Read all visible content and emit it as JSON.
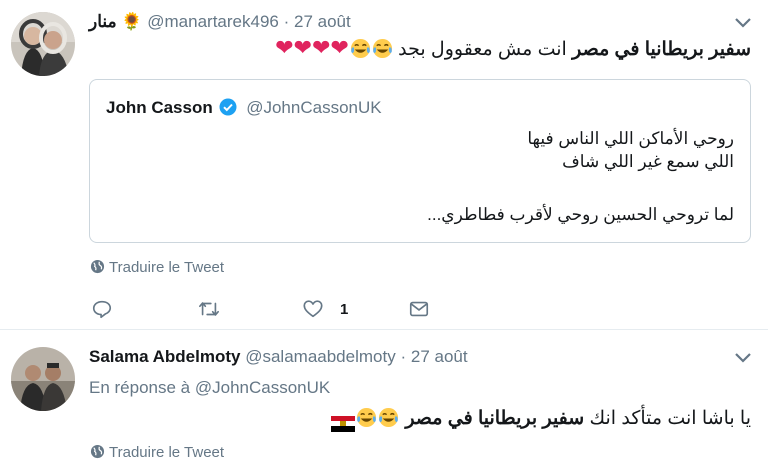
{
  "tweets": [
    {
      "name": "منار",
      "name_emoji": "🌻",
      "handle": "@manartarek496",
      "separator": "·",
      "date": "27 août",
      "text_bold": "سفير بريطانيا في مصر",
      "text_rest": " انت مش معقوول بجد ",
      "text_hearts": "❤❤❤❤",
      "quote": {
        "name": "John Casson",
        "handle": "@JohnCassonUK",
        "lines": [
          "روحي الأماكن اللي الناس فيها",
          "اللي سمع غير اللي شاف",
          "لما تروحي الحسين روحي لأقرب فطاطري..."
        ]
      },
      "translate_label": "Traduire le Tweet",
      "like_count": "1"
    },
    {
      "name": "Salama Abdelmoty",
      "handle": "@salamaabdelmoty",
      "separator": "·",
      "date": "27 août",
      "reply_prefix": "En réponse à",
      "reply_handle": "@JohnCassonUK",
      "text_start": "يا باشا انت متأكد انك ",
      "text_bold": "سفير بريطانيا في مصر",
      "translate_label": "Traduire le Tweet"
    }
  ],
  "colors": {
    "verified": "#1da1f2",
    "heart": "#e0245e",
    "muted": "#657786",
    "border": "#ccd6dd"
  },
  "icons": {
    "menu": "chevron-down-icon",
    "translate": "globe-icon",
    "reply": "reply-icon",
    "retweet": "retweet-icon",
    "like": "heart-icon",
    "dm": "envelope-icon",
    "verified": "verified-badge-icon"
  }
}
